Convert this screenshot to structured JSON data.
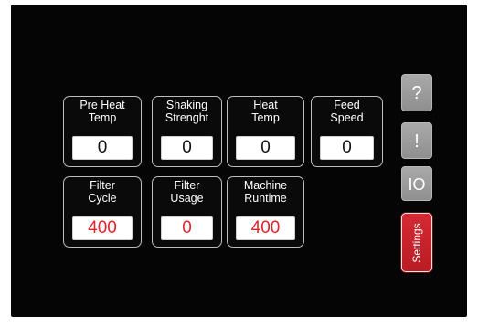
{
  "tiles": [
    {
      "label": "Pre Heat\nTemp",
      "value": "0"
    },
    {
      "label": "Shaking\nStrenght",
      "value": "0"
    },
    {
      "label": "Heat\nTemp",
      "value": "0"
    },
    {
      "label": "Feed\nSpeed",
      "value": "0"
    },
    {
      "label": "Filter\nCycle",
      "value": "400"
    },
    {
      "label": "Filter\nUsage",
      "value": "0"
    },
    {
      "label": "Machine\nRuntime",
      "value": "400"
    }
  ],
  "side_buttons": {
    "help": "?",
    "alarm": "!",
    "io": "IO",
    "settings": "Settings"
  },
  "colors": {
    "background": "#050505",
    "tile_border": "#bdbdbd",
    "value_default": "#111111",
    "value_alert": "#e0252b",
    "side_button": "#9a9a9a",
    "settings_button": "#c5222b"
  },
  "icons": {
    "help": "question-mark-icon",
    "alarm": "exclamation-icon"
  }
}
